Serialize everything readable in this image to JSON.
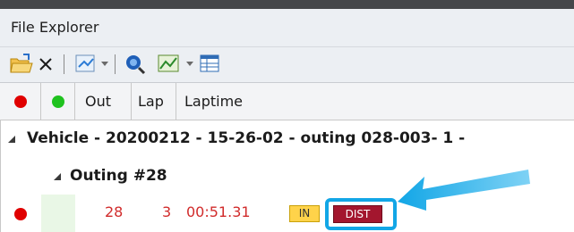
{
  "window": {
    "title": "File Explorer"
  },
  "toolbar": {
    "icons": [
      "open-folder-icon",
      "delete-icon",
      "filter-icon",
      "dropdown-icon",
      "search-icon",
      "chart-icon",
      "dropdown-icon",
      "table-icon"
    ],
    "close_symbol": "✕"
  },
  "columns": [
    "Out",
    "Lap",
    "Laptime"
  ],
  "header_indicators": {
    "red_color": "#e00000",
    "green_color": "#1fc21f"
  },
  "tree": {
    "vehicle_label": "Vehicle - 20200212 - 15-26-02 - outing 028-003- 1 -",
    "outing_label": "Outing #28"
  },
  "lap_row": {
    "out": "28",
    "lap": "3",
    "laptime": "00:51.31",
    "badges": [
      "IN",
      "DIST"
    ]
  },
  "colors": {
    "accent": "#12a6e6",
    "lap_text": "#d12b2b",
    "badge_in": "#ffd34a",
    "badge_dist": "#a3162e"
  }
}
